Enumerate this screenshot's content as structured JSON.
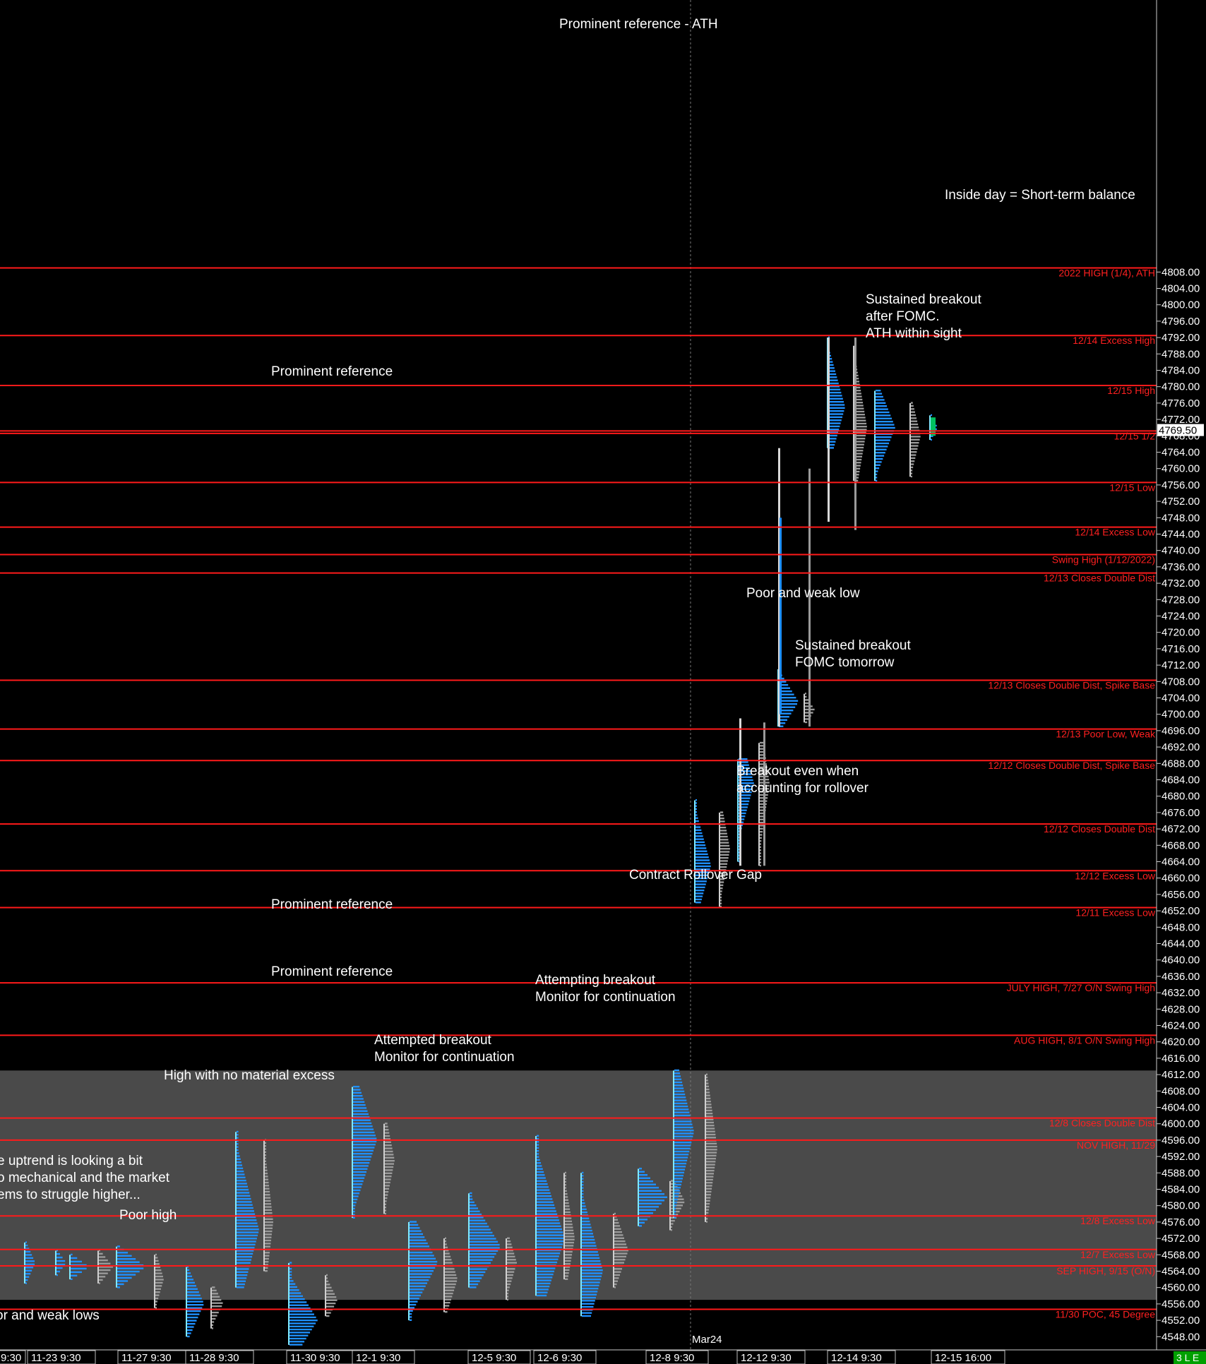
{
  "colors": {
    "background": "#000000",
    "shaded_region": "#4a4a4a",
    "ref_line": "#ff1a1a",
    "ref_label": "#ff2020",
    "annotation": "#ffffff",
    "axis_text": "#ffffff",
    "profile_blue": "#1e90ff",
    "profile_grey": "#9a9a9a",
    "profile_cyan": "#7fe9ff",
    "last_price_box": "#ffffff",
    "status_badge": "#00a000"
  },
  "chart_data": {
    "type": "market-profile",
    "y_axis": {
      "min": 4545,
      "max": 4810,
      "ticks": [
        "4808.00",
        "4804.00",
        "4800.00",
        "4796.00",
        "4792.00",
        "4788.00",
        "4784.00",
        "4780.00",
        "4776.00",
        "4772.00",
        "4768.00",
        "4764.00",
        "4760.00",
        "4756.00",
        "4752.00",
        "4748.00",
        "4744.00",
        "4740.00",
        "4736.00",
        "4732.00",
        "4728.00",
        "4724.00",
        "4720.00",
        "4716.00",
        "4712.00",
        "4708.00",
        "4704.00",
        "4700.00",
        "4696.00",
        "4692.00",
        "4688.00",
        "4684.00",
        "4680.00",
        "4676.00",
        "4672.00",
        "4668.00",
        "4664.00",
        "4660.00",
        "4656.00",
        "4652.00",
        "4648.00",
        "4644.00",
        "4640.00",
        "4636.00",
        "4632.00",
        "4628.00",
        "4624.00",
        "4620.00",
        "4616.00",
        "4612.00",
        "4608.00",
        "4604.00",
        "4600.00",
        "4596.00",
        "4592.00",
        "4588.00",
        "4584.00",
        "4580.00",
        "4576.00",
        "4572.00",
        "4568.00",
        "4564.00",
        "4560.00",
        "4556.00",
        "4552.00",
        "4548.00"
      ],
      "last_price": "4769.50"
    },
    "x_axis_labels": [
      "9:30",
      "11-23  9:30",
      "11-27  9:30",
      "11-28  9:30",
      "11-30  9:30",
      "12-1  9:30",
      "12-5  9:30",
      "12-6  9:30",
      "12-8  9:30",
      "12-12  9:30",
      "12-14  9:30",
      "12-15  16:00"
    ],
    "contract_marker": "Mar24",
    "shaded_region": {
      "from": 4557,
      "to": 4613
    },
    "reference_lines": [
      {
        "price": 4809,
        "label": "2022 HIGH (1/4), ATH"
      },
      {
        "price": 4792.5,
        "label": "12/14 Excess High"
      },
      {
        "price": 4780.3,
        "label": "12/15 High"
      },
      {
        "price": 4769.2,
        "label": "12/15 1/2"
      },
      {
        "price": 4768.6,
        "label": ""
      },
      {
        "price": 4756.6,
        "label": "12/15 Low"
      },
      {
        "price": 4745.7,
        "label": "12/14 Excess Low"
      },
      {
        "price": 4739,
        "label": "Swing High (1/12/2022)"
      },
      {
        "price": 4734.5,
        "label": "12/13 Closes Double Dist"
      },
      {
        "price": 4708.3,
        "label": "12/13 Closes Double Dist, Spike Base"
      },
      {
        "price": 4696.4,
        "label": "12/13 Poor Low, Weak"
      },
      {
        "price": 4688.7,
        "label": "12/12 Closes Double Dist, Spike Base"
      },
      {
        "price": 4673.2,
        "label": "12/12 Closes Double Dist"
      },
      {
        "price": 4661.8,
        "label": "12/12 Excess Low"
      },
      {
        "price": 4652.8,
        "label": "12/11 Excess Low"
      },
      {
        "price": 4634.4,
        "label": "JULY HIGH, 7/27 O/N Swing High"
      },
      {
        "price": 4621.6,
        "label": "AUG HIGH, 8/1 O/N Swing High"
      },
      {
        "price": 4601.4,
        "label": "12/8 Closes Double Dist"
      },
      {
        "price": 4596,
        "label": "NOV HIGH, 11/29"
      },
      {
        "price": 4577.5,
        "label": "12/8 Excess Low"
      },
      {
        "price": 4569.3,
        "label": "12/7 Excess Low"
      },
      {
        "price": 4565.3,
        "label": "SEP HIGH, 9/15 (O/N)"
      },
      {
        "price": 4554.7,
        "label": "11/30 POC, 45 Degree"
      }
    ]
  },
  "annotations": [
    {
      "lines": [
        "Prominent reference - ATH"
      ]
    },
    {
      "lines": [
        "Sustained breakout",
        "after FOMC.",
        "ATH within sight"
      ]
    },
    {
      "lines": [
        "Inside day = Short-term balance"
      ]
    },
    {
      "lines": [
        "Prominent reference"
      ]
    },
    {
      "lines": [
        "Poor and weak low"
      ]
    },
    {
      "lines": [
        "Sustained breakout",
        "FOMC tomorrow"
      ]
    },
    {
      "lines": [
        "Breakout even when",
        "accounting for rollover"
      ]
    },
    {
      "lines": [
        "Contract Rollover Gap"
      ]
    },
    {
      "lines": [
        "Prominent reference"
      ]
    },
    {
      "lines": [
        "Prominent reference"
      ]
    },
    {
      "lines": [
        "Attempting breakout",
        "Monitor for continuation"
      ]
    },
    {
      "lines": [
        "Attempted breakout",
        "Monitor for continuation"
      ]
    },
    {
      "lines": [
        "High with no material excess"
      ]
    },
    {
      "lines": [
        "e uptrend is looking a bit",
        "o mechanical and the market",
        "ems to struggle higher..."
      ]
    },
    {
      "lines": [
        "Poor high"
      ]
    },
    {
      "lines": [
        "or and weak lows"
      ]
    }
  ],
  "status_badge": "3 L E"
}
